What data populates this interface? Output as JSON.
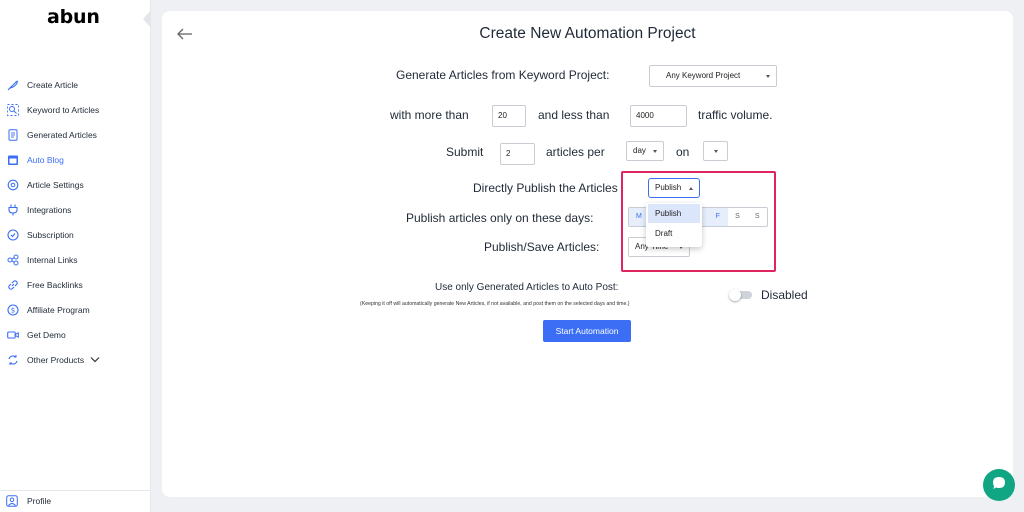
{
  "sidebar": {
    "logo": "abun",
    "items": [
      {
        "label": "Create Article",
        "icon": "feather-icon"
      },
      {
        "label": "Keyword to Articles",
        "icon": "search-keyword-icon"
      },
      {
        "label": "Generated Articles",
        "icon": "document-icon"
      },
      {
        "label": "Auto Blog",
        "icon": "calendar-blog-icon",
        "active": true
      },
      {
        "label": "Article Settings",
        "icon": "settings-icon"
      },
      {
        "label": "Integrations",
        "icon": "plug-icon"
      },
      {
        "label": "Subscription",
        "icon": "subscription-icon"
      },
      {
        "label": "Internal Links",
        "icon": "link-icon"
      },
      {
        "label": "Free Backlinks",
        "icon": "backlink-icon"
      },
      {
        "label": "Affiliate Program",
        "icon": "dollar-icon"
      },
      {
        "label": "Get Demo",
        "icon": "video-icon"
      },
      {
        "label": "Other Products",
        "icon": "refresh-icon"
      }
    ],
    "profile": "Profile"
  },
  "main": {
    "title": "Create New Automation Project",
    "keyword_label": "Generate Articles from Keyword Project:",
    "keyword_select": "Any Keyword Project",
    "traffic_prefix": "with more than",
    "traffic_min": "20",
    "traffic_mid": "and less than",
    "traffic_max": "4000",
    "traffic_suffix": "traffic volume.",
    "submit_label": "Submit",
    "submit_count": "2",
    "articles_per": "articles per",
    "period": "day",
    "on_label": "on",
    "publish_label": "Directly Publish the Articles",
    "publish_select": "Publish",
    "days_label": "Publish articles only on these days:",
    "days": [
      {
        "label": "M",
        "on": true
      },
      {
        "label": "T",
        "on": true
      },
      {
        "label": "W",
        "on": true
      },
      {
        "label": "T",
        "on": true
      },
      {
        "label": "F",
        "on": true
      },
      {
        "label": "S",
        "on": false
      },
      {
        "label": "S",
        "on": false
      }
    ],
    "save_label": "Publish/Save Articles:",
    "save_select": "Any Time",
    "dropdown_options": [
      "Publish",
      "Draft"
    ],
    "generated_label": "Use only Generated Articles to Auto Post:",
    "generated_note": "(Keeping it off will automatically generate New Articles, if not available, and post them on the selected days and time.)",
    "toggle_state": "Disabled",
    "start_button": "Start Automation"
  },
  "colors": {
    "accent": "#3b6ef5",
    "highlight": "#e02460",
    "chat": "#11a683"
  }
}
